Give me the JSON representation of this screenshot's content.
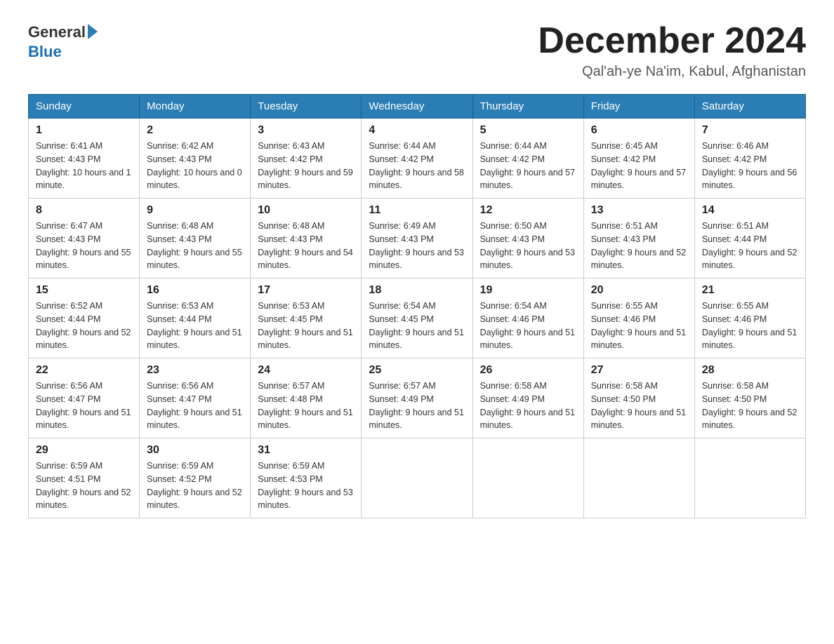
{
  "header": {
    "logo": {
      "general": "General",
      "blue": "Blue"
    },
    "title": "December 2024",
    "subtitle": "Qal'ah-ye Na'im, Kabul, Afghanistan"
  },
  "weekdays": [
    "Sunday",
    "Monday",
    "Tuesday",
    "Wednesday",
    "Thursday",
    "Friday",
    "Saturday"
  ],
  "weeks": [
    [
      {
        "day": "1",
        "sunrise": "6:41 AM",
        "sunset": "4:43 PM",
        "daylight": "10 hours and 1 minute."
      },
      {
        "day": "2",
        "sunrise": "6:42 AM",
        "sunset": "4:43 PM",
        "daylight": "10 hours and 0 minutes."
      },
      {
        "day": "3",
        "sunrise": "6:43 AM",
        "sunset": "4:42 PM",
        "daylight": "9 hours and 59 minutes."
      },
      {
        "day": "4",
        "sunrise": "6:44 AM",
        "sunset": "4:42 PM",
        "daylight": "9 hours and 58 minutes."
      },
      {
        "day": "5",
        "sunrise": "6:44 AM",
        "sunset": "4:42 PM",
        "daylight": "9 hours and 57 minutes."
      },
      {
        "day": "6",
        "sunrise": "6:45 AM",
        "sunset": "4:42 PM",
        "daylight": "9 hours and 57 minutes."
      },
      {
        "day": "7",
        "sunrise": "6:46 AM",
        "sunset": "4:42 PM",
        "daylight": "9 hours and 56 minutes."
      }
    ],
    [
      {
        "day": "8",
        "sunrise": "6:47 AM",
        "sunset": "4:43 PM",
        "daylight": "9 hours and 55 minutes."
      },
      {
        "day": "9",
        "sunrise": "6:48 AM",
        "sunset": "4:43 PM",
        "daylight": "9 hours and 55 minutes."
      },
      {
        "day": "10",
        "sunrise": "6:48 AM",
        "sunset": "4:43 PM",
        "daylight": "9 hours and 54 minutes."
      },
      {
        "day": "11",
        "sunrise": "6:49 AM",
        "sunset": "4:43 PM",
        "daylight": "9 hours and 53 minutes."
      },
      {
        "day": "12",
        "sunrise": "6:50 AM",
        "sunset": "4:43 PM",
        "daylight": "9 hours and 53 minutes."
      },
      {
        "day": "13",
        "sunrise": "6:51 AM",
        "sunset": "4:43 PM",
        "daylight": "9 hours and 52 minutes."
      },
      {
        "day": "14",
        "sunrise": "6:51 AM",
        "sunset": "4:44 PM",
        "daylight": "9 hours and 52 minutes."
      }
    ],
    [
      {
        "day": "15",
        "sunrise": "6:52 AM",
        "sunset": "4:44 PM",
        "daylight": "9 hours and 52 minutes."
      },
      {
        "day": "16",
        "sunrise": "6:53 AM",
        "sunset": "4:44 PM",
        "daylight": "9 hours and 51 minutes."
      },
      {
        "day": "17",
        "sunrise": "6:53 AM",
        "sunset": "4:45 PM",
        "daylight": "9 hours and 51 minutes."
      },
      {
        "day": "18",
        "sunrise": "6:54 AM",
        "sunset": "4:45 PM",
        "daylight": "9 hours and 51 minutes."
      },
      {
        "day": "19",
        "sunrise": "6:54 AM",
        "sunset": "4:46 PM",
        "daylight": "9 hours and 51 minutes."
      },
      {
        "day": "20",
        "sunrise": "6:55 AM",
        "sunset": "4:46 PM",
        "daylight": "9 hours and 51 minutes."
      },
      {
        "day": "21",
        "sunrise": "6:55 AM",
        "sunset": "4:46 PM",
        "daylight": "9 hours and 51 minutes."
      }
    ],
    [
      {
        "day": "22",
        "sunrise": "6:56 AM",
        "sunset": "4:47 PM",
        "daylight": "9 hours and 51 minutes."
      },
      {
        "day": "23",
        "sunrise": "6:56 AM",
        "sunset": "4:47 PM",
        "daylight": "9 hours and 51 minutes."
      },
      {
        "day": "24",
        "sunrise": "6:57 AM",
        "sunset": "4:48 PM",
        "daylight": "9 hours and 51 minutes."
      },
      {
        "day": "25",
        "sunrise": "6:57 AM",
        "sunset": "4:49 PM",
        "daylight": "9 hours and 51 minutes."
      },
      {
        "day": "26",
        "sunrise": "6:58 AM",
        "sunset": "4:49 PM",
        "daylight": "9 hours and 51 minutes."
      },
      {
        "day": "27",
        "sunrise": "6:58 AM",
        "sunset": "4:50 PM",
        "daylight": "9 hours and 51 minutes."
      },
      {
        "day": "28",
        "sunrise": "6:58 AM",
        "sunset": "4:50 PM",
        "daylight": "9 hours and 52 minutes."
      }
    ],
    [
      {
        "day": "29",
        "sunrise": "6:59 AM",
        "sunset": "4:51 PM",
        "daylight": "9 hours and 52 minutes."
      },
      {
        "day": "30",
        "sunrise": "6:59 AM",
        "sunset": "4:52 PM",
        "daylight": "9 hours and 52 minutes."
      },
      {
        "day": "31",
        "sunrise": "6:59 AM",
        "sunset": "4:53 PM",
        "daylight": "9 hours and 53 minutes."
      },
      null,
      null,
      null,
      null
    ]
  ]
}
